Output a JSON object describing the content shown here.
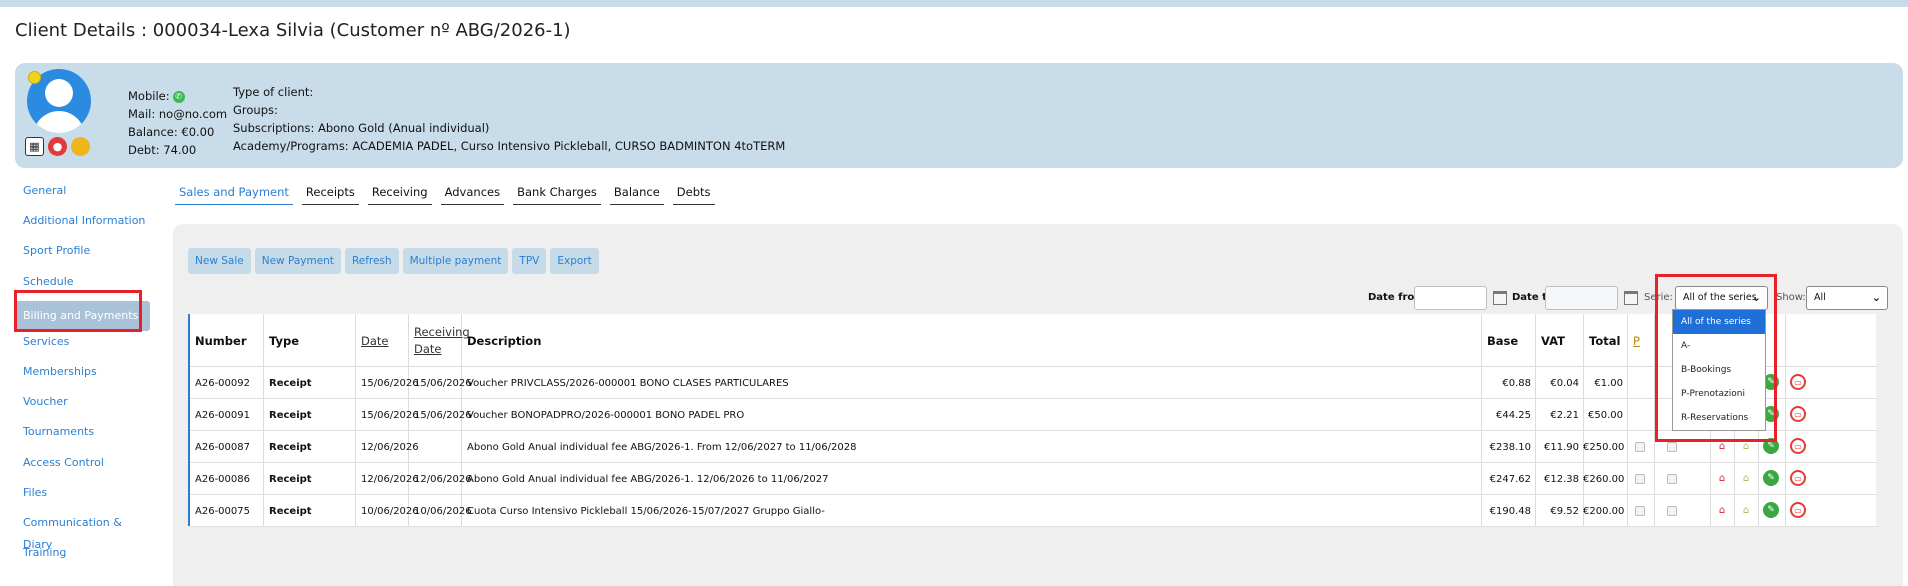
{
  "page": {
    "title": "Client Details : 000034-Lexa Silvia (Customer nº ABG/2026-1)"
  },
  "client": {
    "mobile_label": "Mobile:",
    "mail": "Mail: no@no.com",
    "balance": "Balance: €0.00",
    "debt": "Debt: 74.00",
    "type_of_client": "Type of client:",
    "groups": "Groups:",
    "subscriptions": "Subscriptions: Abono Gold (Anual individual)",
    "academy": "Academy/Programs: ACADEMIA PADEL, Curso Intensivo Pickleball, CURSO BADMINTON 4toTERM",
    "icons": [
      "user-avatar-icon",
      "qr-code-icon",
      "camera-icon",
      "card-icon",
      "whatsapp-icon"
    ]
  },
  "sidebar": {
    "items": [
      {
        "label": "General"
      },
      {
        "label": "Additional Information"
      },
      {
        "label": "Sport Profile"
      },
      {
        "label": "Schedule"
      },
      {
        "label": "Billing and Payments"
      },
      {
        "label": "Services"
      },
      {
        "label": "Memberships"
      },
      {
        "label": "Voucher"
      },
      {
        "label": "Tournaments"
      },
      {
        "label": "Access Control"
      },
      {
        "label": "Files"
      },
      {
        "label": "Communication & Diary"
      },
      {
        "label": "Training"
      }
    ],
    "active_index": 4
  },
  "tabs": [
    {
      "label": "Sales and Payment"
    },
    {
      "label": "Receipts"
    },
    {
      "label": "Receiving"
    },
    {
      "label": "Advances"
    },
    {
      "label": "Bank Charges"
    },
    {
      "label": "Balance"
    },
    {
      "label": "Debts"
    }
  ],
  "buttons": [
    {
      "label": "New Sale"
    },
    {
      "label": "New Payment"
    },
    {
      "label": "Refresh"
    },
    {
      "label": "Multiple payment"
    },
    {
      "label": "TPV"
    },
    {
      "label": "Export"
    }
  ],
  "filters": {
    "date_from_label": "Date from",
    "date_to_label": "Date to",
    "serie_label": "Serie:",
    "serie_value": "All of the series",
    "show_label": "Show:",
    "show_value": "All"
  },
  "table": {
    "headers": {
      "number": "Number",
      "type": "Type",
      "date": "Date",
      "receiving_date_1": "Receiving",
      "receiving_date_2": "Date",
      "description": "Description",
      "base": "Base",
      "vat": "VAT",
      "total": "Total",
      "p": "P"
    },
    "rows": [
      {
        "number": "A26-00092",
        "type": "Receipt",
        "date": "15/06/2026",
        "receiving": "15/06/2026",
        "description": "Voucher PRIVCLASS/2026-000001 BONO CLASES PARTICULARES",
        "base": "€0.88",
        "vat": "€0.04",
        "total": "€1.00"
      },
      {
        "number": "A26-00091",
        "type": "Receipt",
        "date": "15/06/2026",
        "receiving": "15/06/2026",
        "description": "Voucher BONOPADPRO/2026-000001 BONO PADEL PRO",
        "base": "€44.25",
        "vat": "€2.21",
        "total": "€50.00"
      },
      {
        "number": "A26-00087",
        "type": "Receipt",
        "date": "12/06/2026",
        "receiving": "",
        "description": "Abono Gold Anual individual fee ABG/2026-1. From 12/06/2027 to 11/06/2028",
        "base": "€238.10",
        "vat": "€11.90",
        "total": "€250.00"
      },
      {
        "number": "A26-00086",
        "type": "Receipt",
        "date": "12/06/2026",
        "receiving": "12/06/2026",
        "description": "Abono Gold Anual individual fee ABG/2026-1. 12/06/2026 to 11/06/2027",
        "base": "€247.62",
        "vat": "€12.38",
        "total": "€260.00"
      },
      {
        "number": "A26-00075",
        "type": "Receipt",
        "date": "10/06/2026",
        "receiving": "10/06/2026",
        "description": "Cuota Curso Intensivo Pickleball 15/06/2026-15/07/2027 Gruppo Giallo-",
        "base": "€190.48",
        "vat": "€9.52",
        "total": "€200.00"
      }
    ]
  },
  "serie_dropdown": {
    "options": [
      "All of the series",
      "A-",
      "B-Bookings",
      "P-Prenotazioni",
      "R-Reservations"
    ],
    "selected_index": 0
  },
  "colors": {
    "accent": "#2a7fd4",
    "highlight_box": "#e8202a",
    "client_box": "#c9dce9"
  }
}
